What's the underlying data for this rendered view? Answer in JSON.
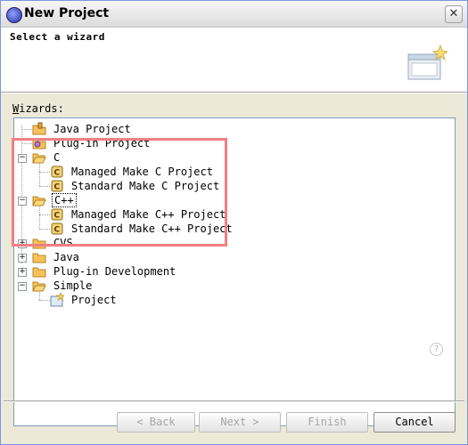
{
  "window": {
    "title": "New Project",
    "close_label": "✕"
  },
  "header": {
    "title": "Select a wizard"
  },
  "wizards_label_underlined": "W",
  "wizards_label_rest": "izards:",
  "tree": {
    "items": [
      {
        "label": "Java Project"
      },
      {
        "label": "Plug-in Project"
      },
      {
        "label": "C"
      },
      {
        "label": "Managed Make C Project"
      },
      {
        "label": "Standard Make C Project"
      },
      {
        "label": "C++"
      },
      {
        "label": "Managed Make C++ Project"
      },
      {
        "label": "Standard Make C++ Project"
      },
      {
        "label": "CVS"
      },
      {
        "label": "Java"
      },
      {
        "label": "Plug-in Development"
      },
      {
        "label": "Simple"
      },
      {
        "label": "Project"
      }
    ],
    "toggle_expanded": "−",
    "toggle_collapsed": "+"
  },
  "help": {
    "label": "?"
  },
  "buttons": {
    "back": "< Back",
    "next": "Next >",
    "finish": "Finish",
    "cancel": "Cancel"
  }
}
